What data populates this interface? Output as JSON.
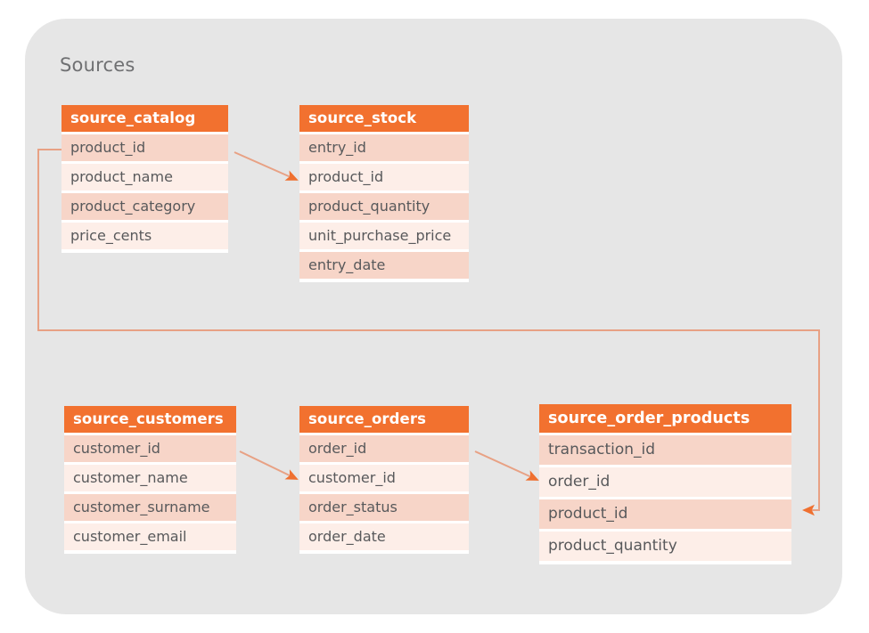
{
  "group": {
    "title": "Sources",
    "background_color": "#e6e6e6"
  },
  "colors": {
    "header_orange": "#f2712f",
    "row_dark": "#f7d5c8",
    "row_light": "#fdeee8",
    "field_text": "#58595b",
    "title_text": "#6f7072",
    "connector_line": "#e8a184",
    "connector_arrow": "#ef7030"
  },
  "tables": [
    {
      "name": "source_catalog",
      "fields": [
        "product_id",
        "product_name",
        "product_category",
        "price_cents"
      ]
    },
    {
      "name": "source_stock",
      "fields": [
        "entry_id",
        "product_id",
        "product_quantity",
        "unit_purchase_price",
        "entry_date"
      ]
    },
    {
      "name": "source_customers",
      "fields": [
        "customer_id",
        "customer_name",
        "customer_surname",
        "customer_email"
      ]
    },
    {
      "name": "source_orders",
      "fields": [
        "order_id",
        "customer_id",
        "order_status",
        "order_date"
      ]
    },
    {
      "name": "source_order_products",
      "fields": [
        "transaction_id",
        "order_id",
        "product_id",
        "product_quantity"
      ]
    }
  ],
  "relationships": [
    {
      "from_table": "source_catalog",
      "from_field": "product_id",
      "to_table": "source_stock",
      "to_field": "product_id",
      "style": "diagonal"
    },
    {
      "from_table": "source_catalog",
      "from_field": "product_id",
      "to_table": "source_order_products",
      "to_field": "product_id",
      "style": "orthogonal"
    },
    {
      "from_table": "source_customers",
      "from_field": "customer_id",
      "to_table": "source_orders",
      "to_field": "customer_id",
      "style": "diagonal"
    },
    {
      "from_table": "source_orders",
      "from_field": "order_id",
      "to_table": "source_order_products",
      "to_field": "order_id",
      "style": "diagonal"
    }
  ]
}
